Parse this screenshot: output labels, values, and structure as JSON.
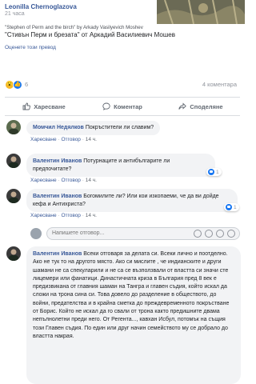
{
  "post": {
    "author": "Leonilla Chernoglazova",
    "time": "21 часа",
    "text_en": "\"Stephen of Perm and the birch\" by Arkady Vasilyevich Moshev",
    "text_bg": "\"Стивън Перм и брезата\" от Аркадий Василиевич Мошев",
    "translate_link": "Оценете този превод",
    "reaction_count": "6",
    "comment_count": "4 коментара"
  },
  "actions": {
    "like": "Харесване",
    "comment": "Коментар",
    "share": "Споделяне"
  },
  "comments": [
    {
      "name": "Момчил Недялков",
      "text": "Покръстители ли славим?",
      "like": "Харесване",
      "reply": "Отговор",
      "time": "14 ч."
    },
    {
      "name": "Валентин Иванов",
      "text": "Потурнаците и антибългарите ли предпочитате?",
      "like": "Харесване",
      "reply": "Отговор",
      "time": "14 ч.",
      "likes": "1"
    },
    {
      "name": "Валентин Иванов",
      "text": "Богомилите ли? Или кои изкопаеми, че да ви дойде кефа и Антихриста?",
      "like": "Харесване",
      "reply": "Отговор",
      "time": "14 ч.",
      "likes": "1"
    },
    {
      "name": "Валентин Иванов",
      "text": "Всеки отговаря за делата си. Всеки лично и поотделно. Ако не тук то на другото място. Ако си мислите , че индианските и други шамани не са спекуларили и не са се възползвали от властта си значи сте лицемери или фанатици. Династичната криза в България пред 8 век е предизвикана от главния шаман на Тангра и главен съдия, който искал да сложи на трона сина си. Това довело до разделение в обществото, до войни, предателства и в крайна сметка до преждевременното покръстване от Борис. Който не искал да го свали от трона както предишните двама непълнолетни преди него. От Регента..., кавхан Исбул, потомък на същия този Главен съдия. По един или друг начин семейството му се добрало до властта накрая."
    }
  ],
  "reply_placeholder": "Напишете отговор...",
  "colors": {
    "link": "#385898",
    "bubble": "#f2f3f5",
    "like_blue": "#1877f2"
  }
}
